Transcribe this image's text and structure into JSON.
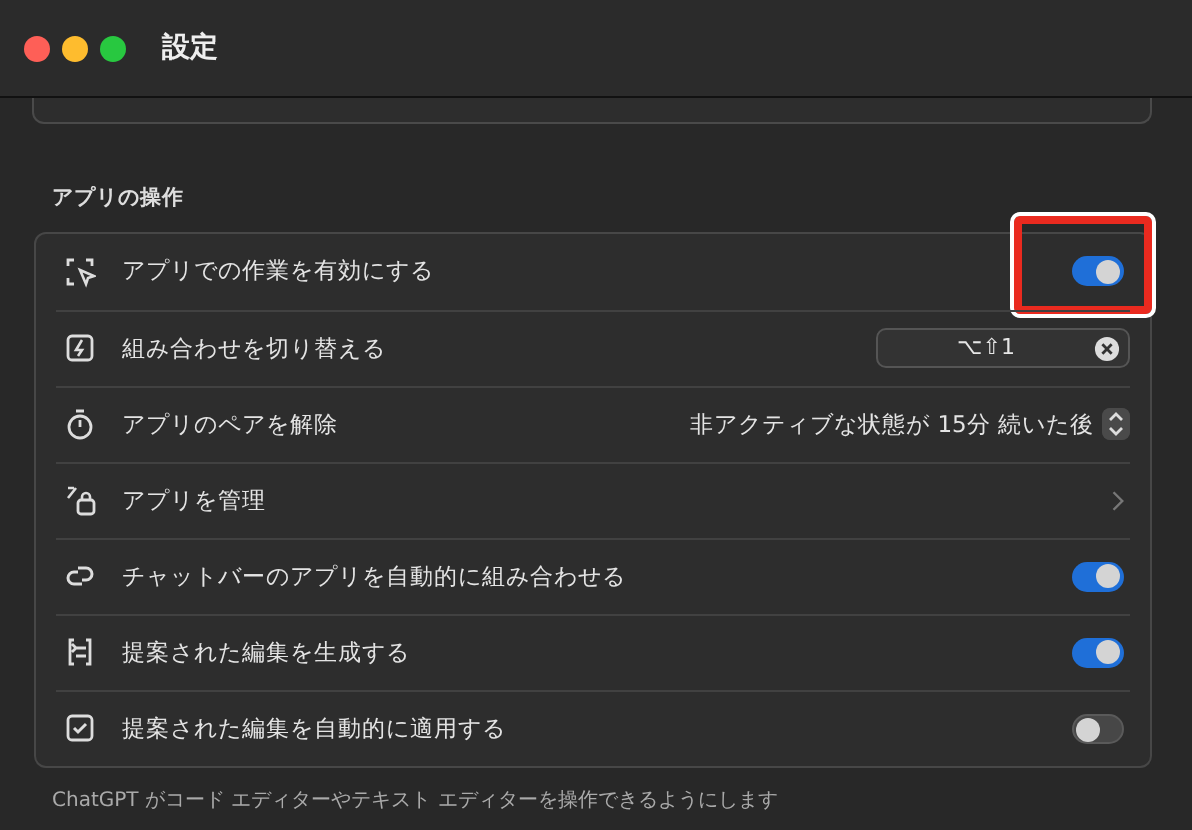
{
  "window": {
    "title": "設定"
  },
  "section": {
    "title": "アプリの操作",
    "rows": [
      {
        "kind": "toggle",
        "label": "アプリでの作業を有効にする",
        "on": true,
        "highlighted": true
      },
      {
        "kind": "shortcut",
        "label": "組み合わせを切り替える",
        "value": "⌥⇧1"
      },
      {
        "kind": "select",
        "label": "アプリのペアを解除",
        "value": "非アクティブな状態が 15分 続いた後"
      },
      {
        "kind": "link",
        "label": "アプリを管理"
      },
      {
        "kind": "toggle",
        "label": "チャットバーのアプリを自動的に組み合わせる",
        "on": true,
        "highlighted": false
      },
      {
        "kind": "toggle",
        "label": "提案された編集を生成する",
        "on": true,
        "highlighted": false
      },
      {
        "kind": "toggle",
        "label": "提案された編集を自動的に適用する",
        "on": false,
        "highlighted": false
      }
    ],
    "footer": "ChatGPT がコード エディターやテキスト エディターを操作できるようにします"
  }
}
